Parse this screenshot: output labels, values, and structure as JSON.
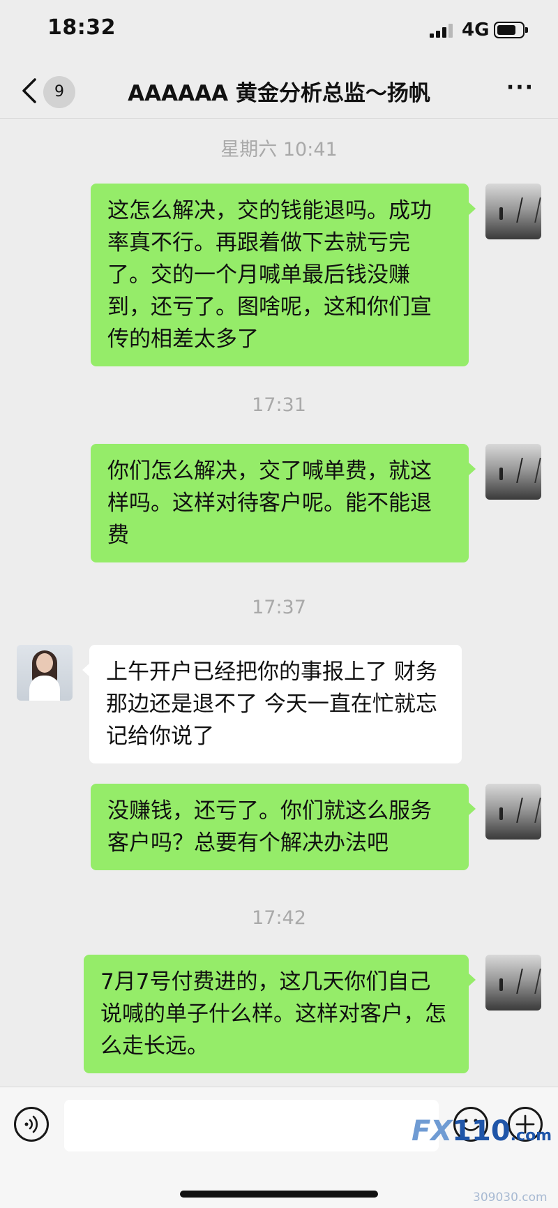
{
  "status_bar": {
    "time": "18:32",
    "network": "4G"
  },
  "navbar": {
    "back_count": "9",
    "title": "AAAAAA 黄金分析总监～扬帆",
    "more": "···"
  },
  "messages": [
    {
      "type": "timestamp",
      "text": "星期六 10:41"
    },
    {
      "type": "outgoing",
      "text": "这怎么解决，交的钱能退吗。成功率真不行。再跟着做下去就亏完了。交的一个月喊单最后钱没赚到，还亏了。图啥呢，这和你们宣传的相差太多了"
    },
    {
      "type": "timestamp",
      "text": "17:31"
    },
    {
      "type": "outgoing",
      "text": "你们怎么解决，交了喊单费，就这样吗。这样对待客户呢。能不能退费"
    },
    {
      "type": "timestamp",
      "text": "17:37"
    },
    {
      "type": "incoming",
      "text": "上午开户已经把你的事报上了 财务那边还是退不了 今天一直在忙就忘记给你说了"
    },
    {
      "type": "outgoing",
      "text": "没赚钱，还亏了。你们就这么服务客户吗？总要有个解决办法吧"
    },
    {
      "type": "timestamp",
      "text": "17:42"
    },
    {
      "type": "outgoing",
      "text": "7月7号付费进的，这几天你们自己说喊的单子什么样。这样对客户，怎么走长远。"
    }
  ],
  "watermark": {
    "fx": "FX",
    "number": "110",
    "domain": ".com",
    "sub": "309030.com"
  }
}
